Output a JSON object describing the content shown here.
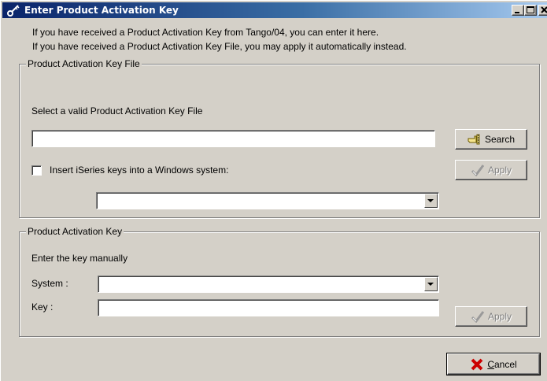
{
  "window": {
    "title": "Enter Product Activation Key"
  },
  "info": {
    "line1": "If you have received a Product Activation Key from Tango/04, you can enter it here.",
    "line2": "If you have received a Product Activation Key File, you may apply it automatically instead."
  },
  "key_file_group": {
    "legend": "Product Activation Key File",
    "instruction": "Select a valid Product Activation Key File",
    "file_value": "",
    "search_label": "Search",
    "checkbox_label": "Insert iSeries keys into a Windows system:",
    "checkbox_checked": false,
    "system_value": "",
    "apply_label": "Apply"
  },
  "key_group": {
    "legend": "Product Activation Key",
    "instruction": "Enter the key manually",
    "system_label": "System :",
    "system_value": "",
    "key_label": "Key :",
    "key_value": "",
    "apply_label": "Apply"
  },
  "footer": {
    "cancel_label": "Cancel"
  },
  "colors": {
    "title_start": "#0a246a",
    "title_end": "#a6caf0",
    "face": "#d4d0c8",
    "cancel_x": "#cc0000",
    "check_green": "#808080"
  }
}
